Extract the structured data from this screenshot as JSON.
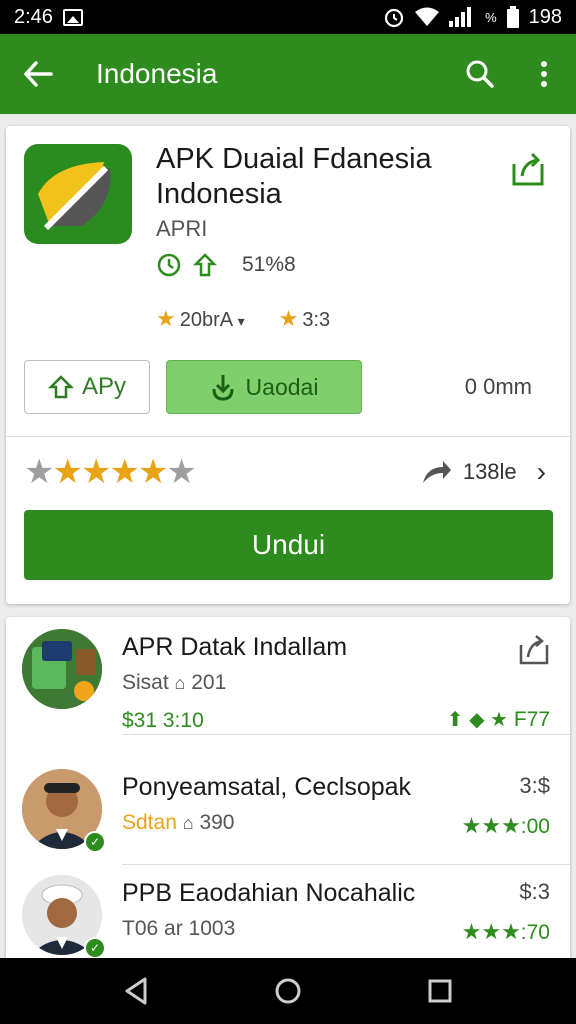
{
  "status": {
    "time": "2:46",
    "battery": "198",
    "signal_label": "%"
  },
  "appbar": {
    "title": "Indonesia"
  },
  "app": {
    "title": "APK Duaial Fdanesia Indonesia",
    "developer": "APRI",
    "meta_value": "51%8",
    "rating_a": "20brA",
    "rating_b": "3:3",
    "btn_apy": "APy",
    "btn_uaodai": "Uaodai",
    "size": "0mm",
    "shares": "138le",
    "rating_stars": 4,
    "download_label": "Undui"
  },
  "list": [
    {
      "name": "APR Datak Indallam",
      "sub_text": "Sisat",
      "sub_count": "201",
      "price": "$31 3:10",
      "right_top": "",
      "right_bottom": "F77"
    },
    {
      "name": "Ponyeamsatal, Ceclsopak",
      "sub_text": "Sdtan",
      "sub_count": "390",
      "price": "",
      "right_top": "3:$",
      "right_bottom": ":00"
    },
    {
      "name": "PPB Eaodahian Nocahalic",
      "sub_text": "T06 ar 1003",
      "sub_count": "",
      "price": "",
      "right_top": "$:3",
      "right_bottom": ":70"
    }
  ],
  "colors": {
    "primary": "#2e8b1e",
    "star": "#e8a317",
    "light_green": "#7fcf6c"
  }
}
